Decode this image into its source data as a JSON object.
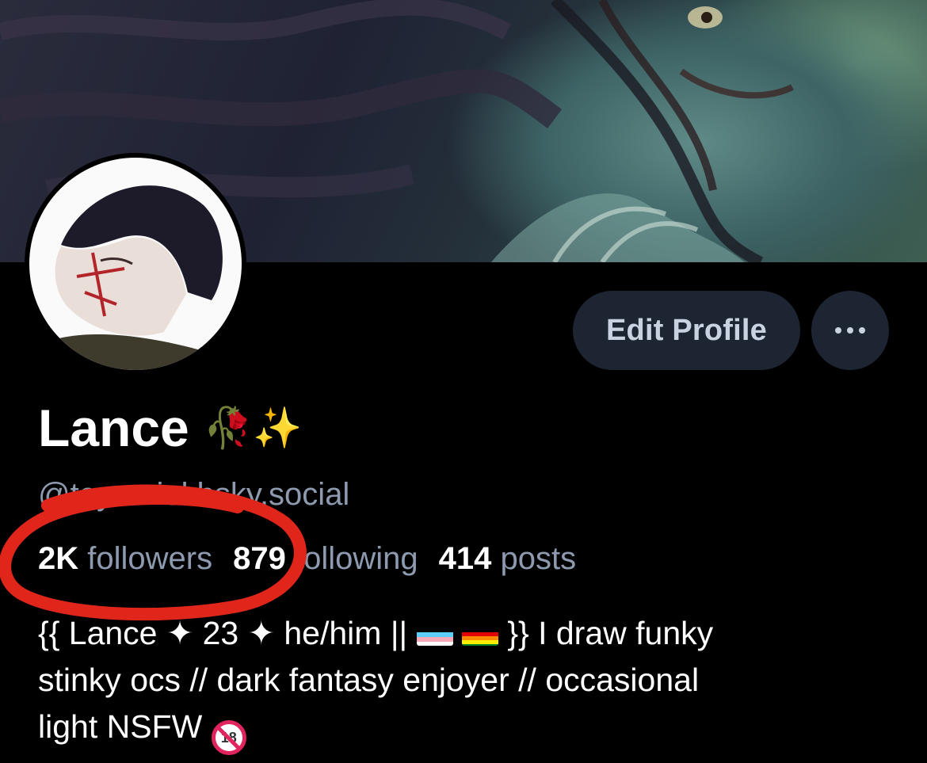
{
  "profile": {
    "display_name": "Lance",
    "name_emoji": "🥀✨",
    "handle": "@teyomiel.bsky.social",
    "edit_label": "Edit Profile",
    "stats": {
      "followers_count": "2K",
      "followers_label": "followers",
      "following_count": "879",
      "following_label": "following",
      "posts_count": "414",
      "posts_label": "posts"
    },
    "bio": {
      "line1_a": "{{ Lance ✦ 23 ✦ he/him || ",
      "line1_b": " }} I draw funky",
      "line2": "stinky ocs // dark fantasy enjoyer // occasional",
      "line3": "light NSFW ",
      "no18_text": "18"
    }
  },
  "icons": {
    "more": "more-horizontal-icon",
    "trans_flag": "transgender-flag-icon",
    "rainbow_flag": "rainbow-flag-icon",
    "no_under_18": "no-one-under-eighteen-icon"
  },
  "colors": {
    "background": "#000000",
    "button_bg": "#1e2532",
    "button_text": "#c8d2e0",
    "muted_text": "#8e9aaf",
    "annotation_red": "#e0261b"
  }
}
